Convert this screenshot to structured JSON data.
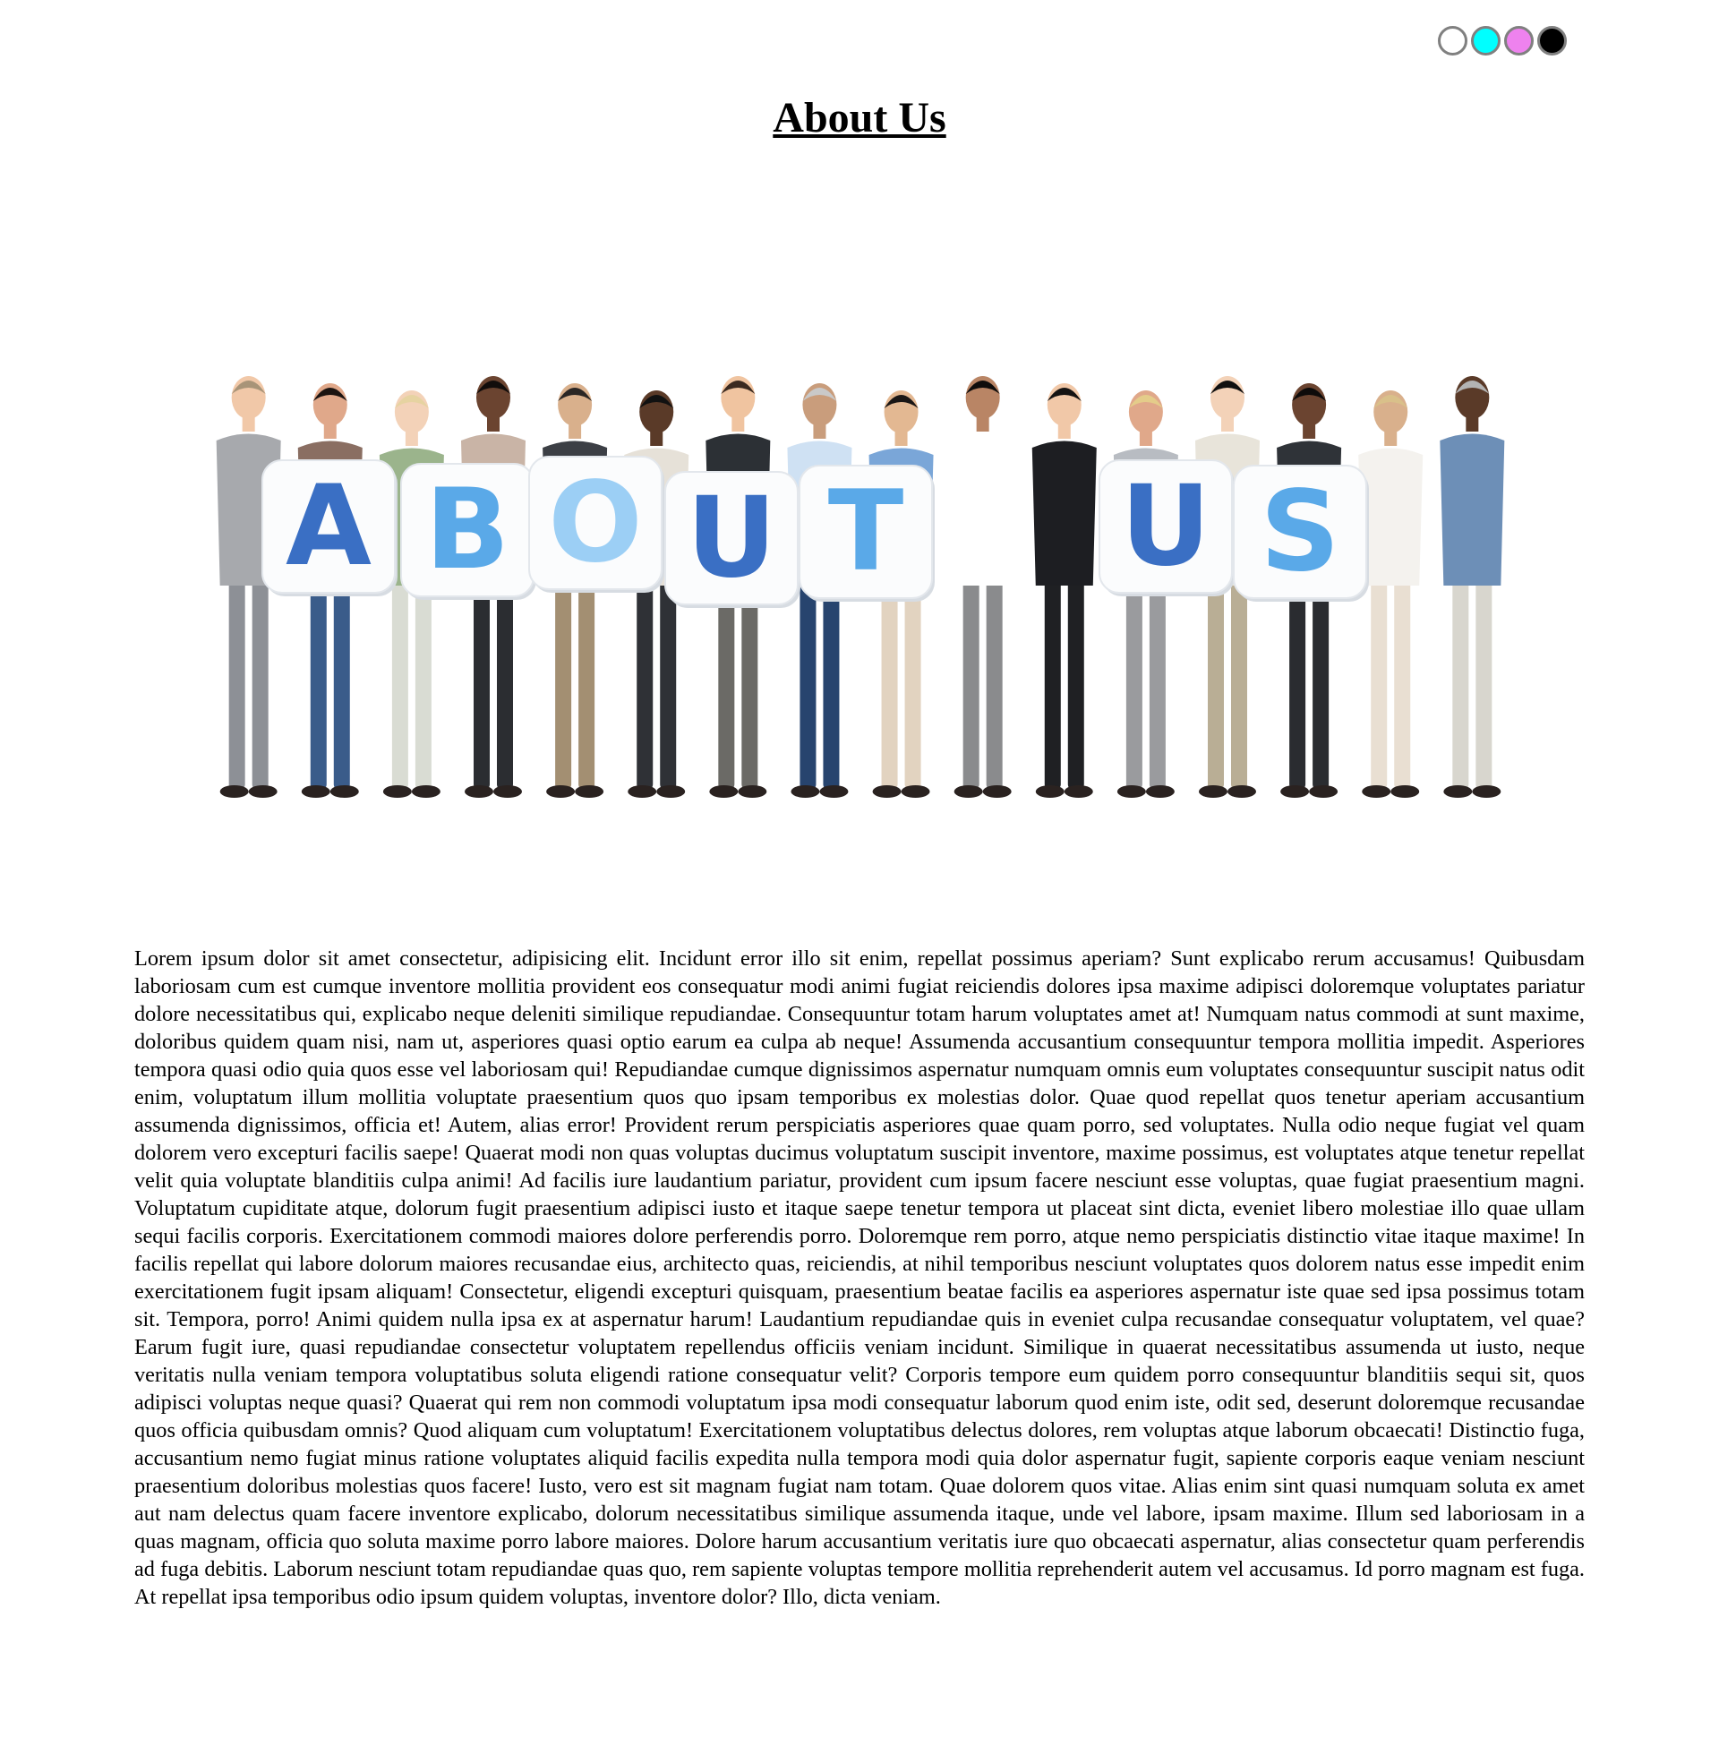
{
  "theme_switcher": {
    "swatches": [
      {
        "name": "white",
        "color": "#ffffff"
      },
      {
        "name": "cyan",
        "color": "#00ffff"
      },
      {
        "name": "violet",
        "color": "#ee82ee"
      },
      {
        "name": "black",
        "color": "#000000"
      }
    ]
  },
  "page_title": "About Us",
  "hero": {
    "sign_letters": [
      "A",
      "B",
      "O",
      "U",
      "T",
      "U",
      "S"
    ],
    "letter_colors": [
      "#3a6fc4",
      "#5aa9e8",
      "#9ccff5",
      "#3a6fc4",
      "#5aa9e8",
      "#3a6fc4",
      "#5aa9e8"
    ]
  },
  "body_text": "Lorem ipsum dolor sit amet consectetur, adipisicing elit. Incidunt error illo sit enim, repellat possimus aperiam? Sunt explicabo rerum accusamus! Quibusdam laboriosam cum est cumque inventore mollitia provident eos consequatur modi animi fugiat reiciendis dolores ipsa maxime adipisci doloremque voluptates pariatur dolore necessitatibus qui, explicabo neque deleniti similique repudiandae. Consequuntur totam harum voluptates amet at! Numquam natus commodi at sunt maxime, doloribus quidem quam nisi, nam ut, asperiores quasi optio earum ea culpa ab neque! Assumenda accusantium consequuntur tempora mollitia impedit. Asperiores tempora quasi odio quia quos esse vel laboriosam qui! Repudiandae cumque dignissimos aspernatur numquam omnis eum voluptates consequuntur suscipit natus odit enim, voluptatum illum mollitia voluptate praesentium quos quo ipsam temporibus ex molestias dolor. Quae quod repellat quos tenetur aperiam accusantium assumenda dignissimos, officia et! Autem, alias error! Provident rerum perspiciatis asperiores quae quam porro, sed voluptates. Nulla odio neque fugiat vel quam dolorem vero excepturi facilis saepe! Quaerat modi non quas voluptas ducimus voluptatum suscipit inventore, maxime possimus, est voluptates atque tenetur repellat velit quia voluptate blanditiis culpa animi! Ad facilis iure laudantium pariatur, provident cum ipsum facere nesciunt esse voluptas, quae fugiat praesentium magni. Voluptatum cupiditate atque, dolorum fugit praesentium adipisci iusto et itaque saepe tenetur tempora ut placeat sint dicta, eveniet libero molestiae illo quae ullam sequi facilis corporis. Exercitationem commodi maiores dolore perferendis porro. Doloremque rem porro, atque nemo perspiciatis distinctio vitae itaque maxime! In facilis repellat qui labore dolorum maiores recusandae eius, architecto quas, reiciendis, at nihil temporibus nesciunt voluptates quos dolorem natus esse impedit enim exercitationem fugit ipsam aliquam! Consectetur, eligendi excepturi quisquam, praesentium beatae facilis ea asperiores aspernatur iste quae sed ipsa possimus totam sit. Tempora, porro! Animi quidem nulla ipsa ex at aspernatur harum! Laudantium repudiandae quis in eveniet culpa recusandae consequatur voluptatem, vel quae? Earum fugit iure, quasi repudiandae consectetur voluptatem repellendus officiis veniam incidunt. Similique in quaerat necessitatibus assumenda ut iusto, neque veritatis nulla veniam tempora voluptatibus soluta eligendi ratione consequatur velit? Corporis tempore eum quidem porro consequuntur blanditiis sequi sit, quos adipisci voluptas neque quasi? Quaerat qui rem non commodi voluptatum ipsa modi consequatur laborum quod enim iste, odit sed, deserunt doloremque recusandae quos officia quibusdam omnis? Quod aliquam cum voluptatum! Exercitationem voluptatibus delectus dolores, rem voluptas atque laborum obcaecati! Distinctio fuga, accusantium nemo fugiat minus ratione voluptates aliquid facilis expedita nulla tempora modi quia dolor aspernatur fugit, sapiente corporis eaque veniam nesciunt praesentium doloribus molestias quos facere! Iusto, vero est sit magnam fugiat nam totam. Quae dolorem quos vitae. Alias enim sint quasi numquam soluta ex amet aut nam delectus quam facere inventore explicabo, dolorum necessitatibus similique assumenda itaque, unde vel labore, ipsam maxime. Illum sed laboriosam in a quas magnam, officia quo soluta maxime porro labore maiores. Dolore harum accusantium veritatis iure quo obcaecati aspernatur, alias consectetur quam perferendis ad fuga debitis. Laborum nesciunt totam repudiandae quas quo, rem sapiente voluptas tempore mollitia reprehenderit autem vel accusamus. Id porro magnam est fuga. At repellat ipsa temporibus odio ipsum quidem voluptas, inventore dolor? Illo, dicta veniam."
}
